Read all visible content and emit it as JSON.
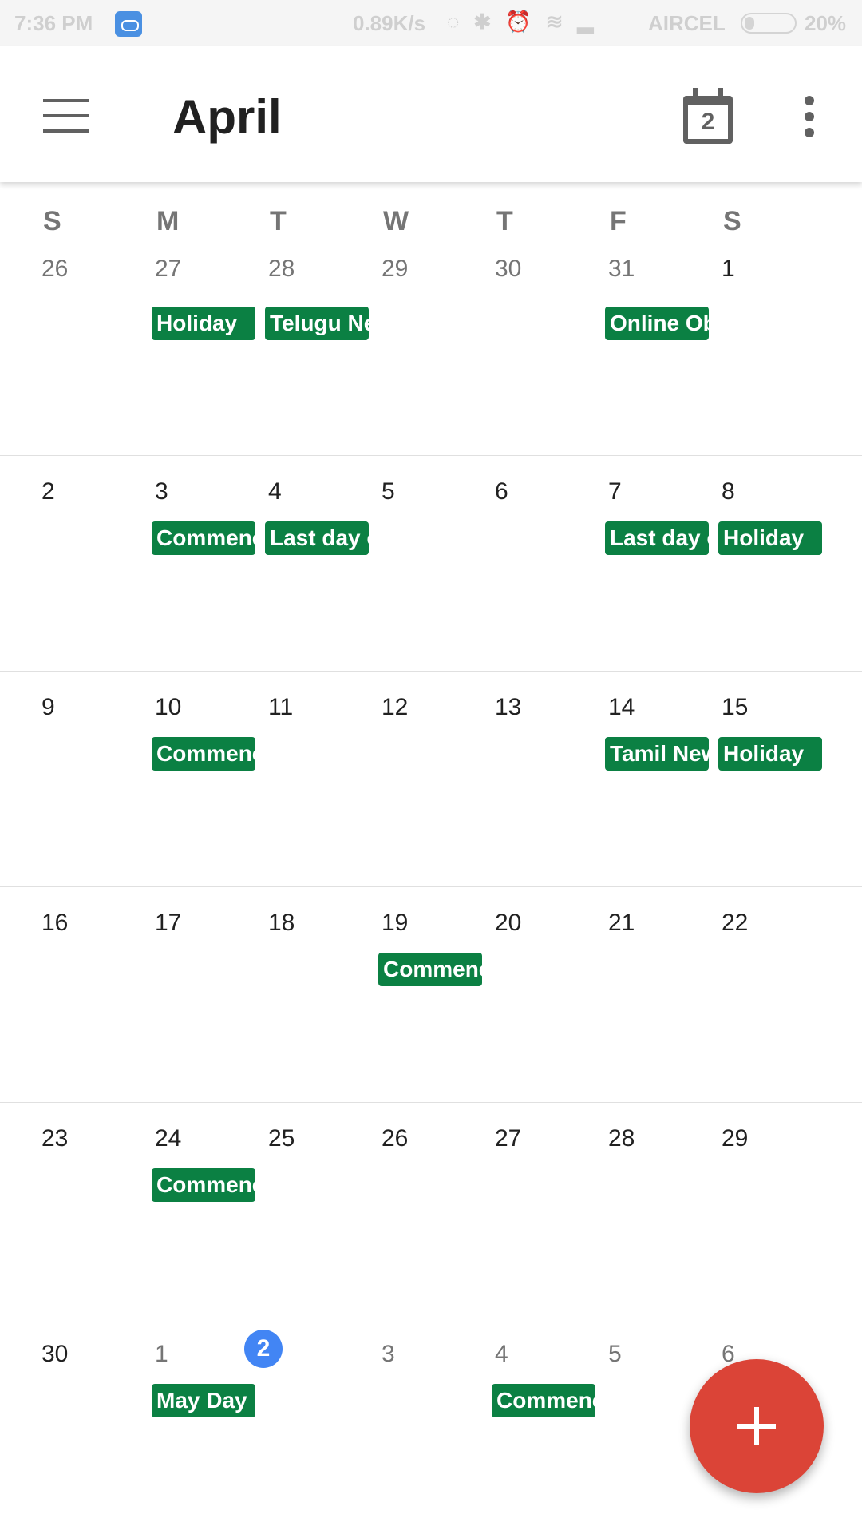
{
  "status_bar": {
    "time": "7:36 PM",
    "network_speed": "0.89K/s",
    "carrier": "AIRCEL",
    "battery": "20%"
  },
  "app_bar": {
    "title": "April",
    "today_day": "2"
  },
  "weekdays": [
    "S",
    "M",
    "T",
    "W",
    "T",
    "F",
    "S"
  ],
  "weeks": [
    {
      "days": [
        "26",
        "27",
        "28",
        "29",
        "30",
        "31",
        "1"
      ],
      "current_month_flags": [
        false,
        false,
        false,
        false,
        false,
        false,
        true
      ],
      "events": [
        {
          "col": 1,
          "label": "Holiday"
        },
        {
          "col": 2,
          "label": "Telugu New"
        },
        {
          "col": 5,
          "label": "Online Ob"
        }
      ]
    },
    {
      "days": [
        "2",
        "3",
        "4",
        "5",
        "6",
        "7",
        "8"
      ],
      "current_month_flags": [
        true,
        true,
        true,
        true,
        true,
        true,
        true
      ],
      "events": [
        {
          "col": 1,
          "label": "Commence"
        },
        {
          "col": 2,
          "label": "Last day o"
        },
        {
          "col": 5,
          "label": "Last day o"
        },
        {
          "col": 6,
          "label": "Holiday"
        }
      ]
    },
    {
      "days": [
        "9",
        "10",
        "11",
        "12",
        "13",
        "14",
        "15"
      ],
      "current_month_flags": [
        true,
        true,
        true,
        true,
        true,
        true,
        true
      ],
      "events": [
        {
          "col": 1,
          "label": "Commence"
        },
        {
          "col": 5,
          "label": "Tamil New"
        },
        {
          "col": 6,
          "label": "Holiday"
        }
      ]
    },
    {
      "days": [
        "16",
        "17",
        "18",
        "19",
        "20",
        "21",
        "22"
      ],
      "current_month_flags": [
        true,
        true,
        true,
        true,
        true,
        true,
        true
      ],
      "events": [
        {
          "col": 3,
          "label": "Commence"
        }
      ]
    },
    {
      "days": [
        "23",
        "24",
        "25",
        "26",
        "27",
        "28",
        "29"
      ],
      "current_month_flags": [
        true,
        true,
        true,
        true,
        true,
        true,
        true
      ],
      "events": [
        {
          "col": 1,
          "label": "Commence"
        }
      ]
    },
    {
      "days": [
        "30",
        "1",
        "2",
        "3",
        "4",
        "5",
        "6"
      ],
      "current_month_flags": [
        true,
        false,
        false,
        false,
        false,
        false,
        false
      ],
      "today_col": 2,
      "events": [
        {
          "col": 1,
          "label": "May Day"
        },
        {
          "col": 4,
          "label": "Commence"
        }
      ]
    }
  ],
  "colors": {
    "event": "#0b8043",
    "today": "#4285f4",
    "fab": "#db4437"
  }
}
